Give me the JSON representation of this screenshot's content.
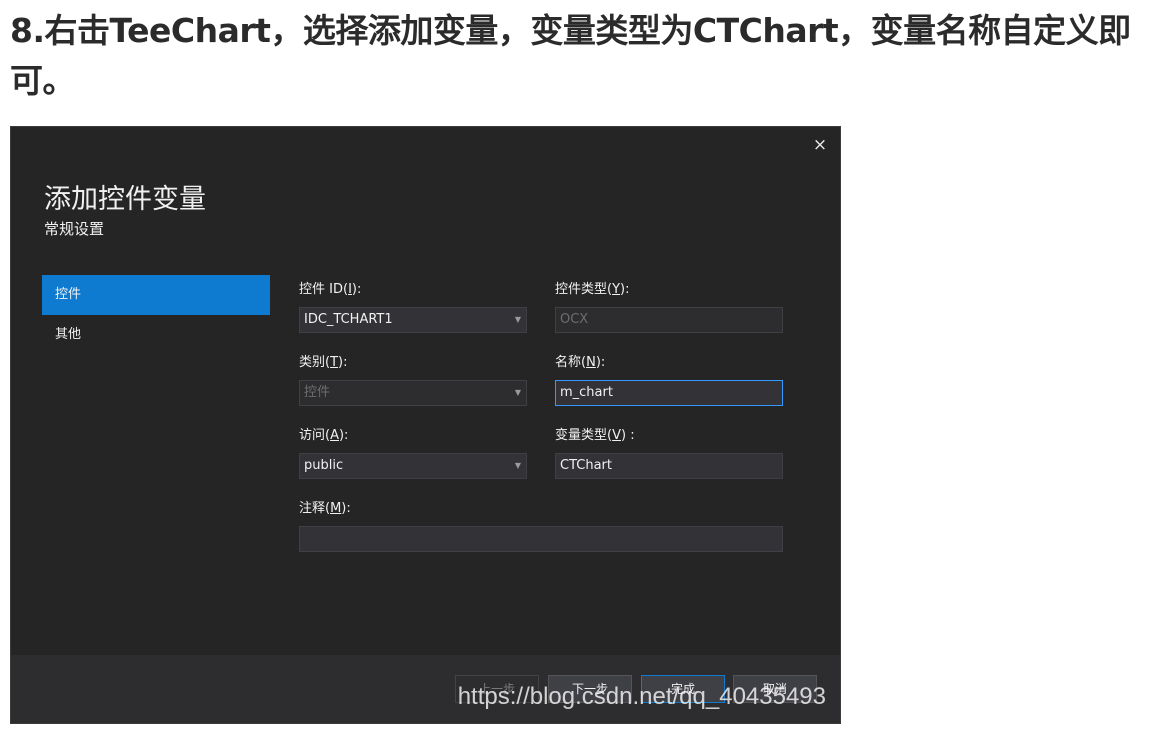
{
  "heading": "8.右击TeeChart，选择添加变量，变量类型为CTChart，变量名称自定义即可。",
  "dialog": {
    "close_glyph": "×",
    "title": "添加控件变量",
    "subtitle": "常规设置",
    "nav": [
      "控件",
      "其他"
    ],
    "fields": {
      "control_id": {
        "label_prefix": "控件 ID(",
        "hotkey": "I",
        "label_suffix": "):",
        "value": "IDC_TCHART1"
      },
      "control_type": {
        "label_prefix": "控件类型(",
        "hotkey": "Y",
        "label_suffix": "):",
        "value": "OCX"
      },
      "category": {
        "label_prefix": "类别(",
        "hotkey": "T",
        "label_suffix": "):",
        "value": "控件"
      },
      "name": {
        "label_prefix": "名称(",
        "hotkey": "N",
        "label_suffix": "):",
        "value": "m_chart"
      },
      "access": {
        "label_prefix": "访问(",
        "hotkey": "A",
        "label_suffix": "):",
        "value": "public"
      },
      "variable_type": {
        "label_prefix": "变量类型(",
        "hotkey": "V",
        "label_suffix": ") :",
        "value": "CTChart"
      },
      "comment": {
        "label_prefix": "注释(",
        "hotkey": "M",
        "label_suffix": "):",
        "value": ""
      }
    },
    "buttons": {
      "prev": "上一步",
      "next": "下一步",
      "finish": "完成",
      "cancel": "取消"
    }
  },
  "watermark": "https://blog.csdn.net/qq_40435493",
  "colors": {
    "dialog_bg": "#252526",
    "footer_bg": "#2d2d30",
    "accent": "#0e7ad0",
    "focus_border": "#3399ff"
  }
}
